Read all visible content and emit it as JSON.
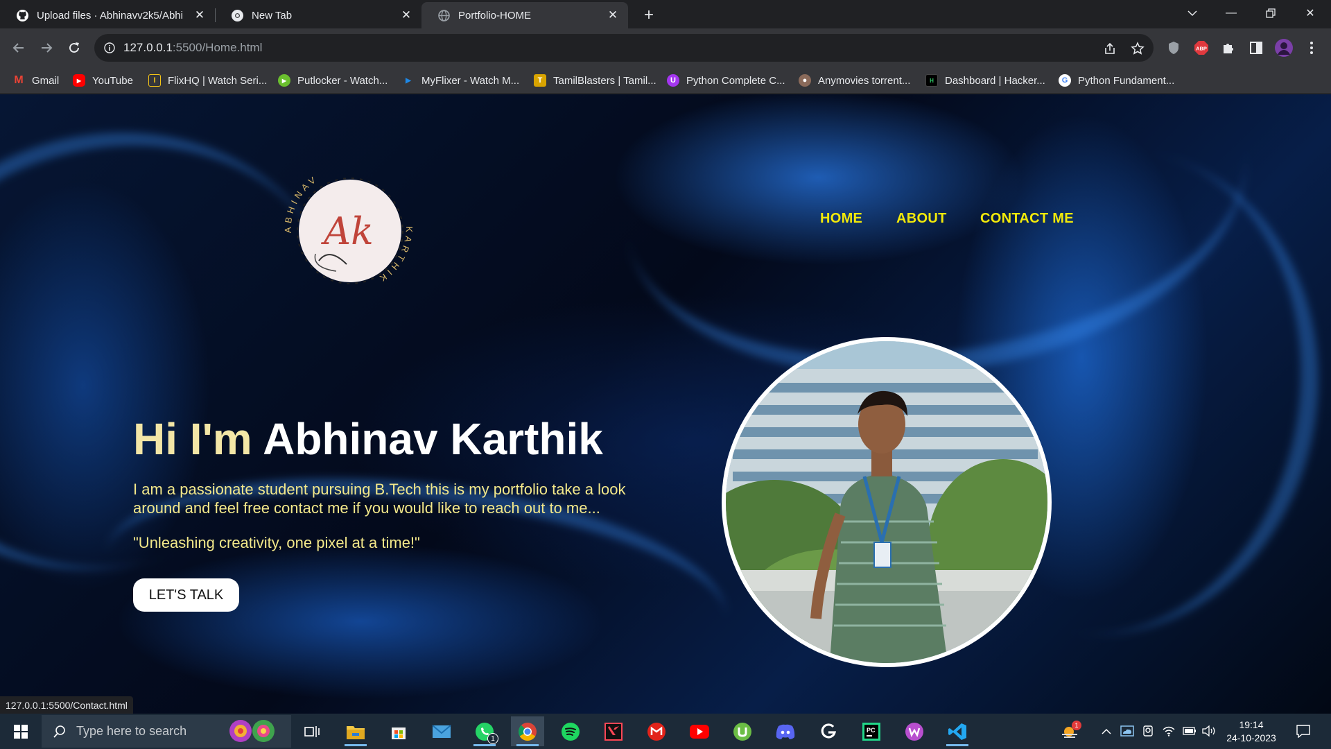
{
  "browser": {
    "tabs": [
      {
        "title": "Upload files · Abhinavv2k5/Abhi",
        "icon": "github-icon",
        "active": false
      },
      {
        "title": "New Tab",
        "icon": "chrome-icon",
        "active": false
      },
      {
        "title": "Portfolio-HOME",
        "icon": "globe-icon",
        "active": true
      }
    ],
    "address": {
      "host": "127.0.0.1",
      "path": ":5500/Home.html"
    },
    "bookmarks": [
      {
        "label": "Gmail",
        "icon": "gmail-icon",
        "color": "#ea4335"
      },
      {
        "label": "YouTube",
        "icon": "youtube-icon",
        "color": "#ff0000"
      },
      {
        "label": "FlixHQ | Watch Seri...",
        "icon": "flixhq-icon",
        "color": "#f5c518"
      },
      {
        "label": "Putlocker - Watch...",
        "icon": "putlocker-icon",
        "color": "#6abf2e"
      },
      {
        "label": "MyFlixer - Watch M...",
        "icon": "myflixer-icon",
        "color": "#1e88e5"
      },
      {
        "label": "TamilBlasters | Tamil...",
        "icon": "tamilblasters-icon",
        "color": "#d9a400"
      },
      {
        "label": "Python Complete C...",
        "icon": "udemy-icon",
        "color": "#a435f0"
      },
      {
        "label": "Anymovies torrent...",
        "icon": "anymovies-icon",
        "color": "#8a6a5a"
      },
      {
        "label": "Dashboard | Hacker...",
        "icon": "hackerrank-icon",
        "color": "#000000"
      },
      {
        "label": "Python Fundament...",
        "icon": "google-icon",
        "color": "#4285f4"
      }
    ],
    "status_url": "127.0.0.1:5500/Contact.html"
  },
  "page": {
    "logo": {
      "monogram": "Ak",
      "arc_top": "ABHINAV",
      "arc_bottom": "KARTHIK"
    },
    "nav": [
      "HOME",
      "ABOUT",
      "CONTACT ME"
    ],
    "hero": {
      "greeting": "Hi I'm",
      "name": "Abhinav Karthik",
      "description": "I am a passionate student pursuing B.Tech this is my portfolio take a look around and feel free contact me if you would like to reach out to me...",
      "quote": "\"Unleashing creativity, one pixel at a time!\"",
      "cta": "LET'S TALK"
    },
    "colors": {
      "nav": "#f2e90a",
      "accent_text": "#f3e88a"
    }
  },
  "taskbar": {
    "search_placeholder": "Type here to search",
    "whatsapp_badge": "1",
    "time": "19:14",
    "date": "24-10-2023",
    "weather_badge": "1"
  }
}
